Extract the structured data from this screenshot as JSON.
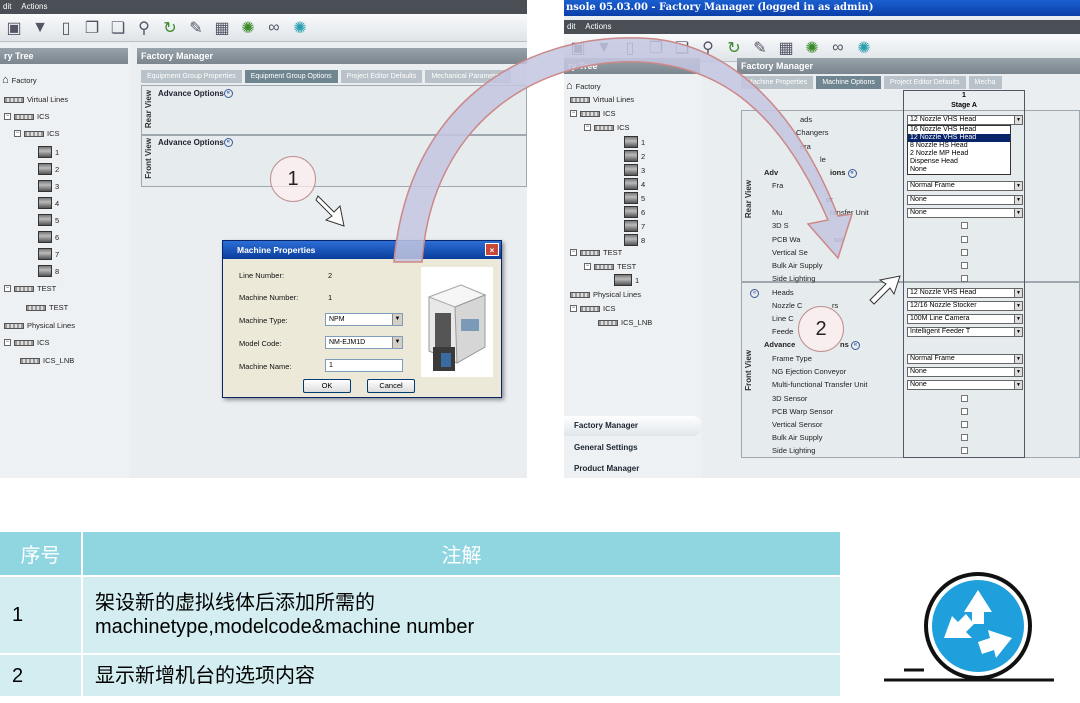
{
  "left_shot": {
    "menu": [
      "dit",
      "Actions"
    ],
    "tree_header": "ry Tree",
    "tree": [
      {
        "label": "Factory"
      },
      {
        "label": "Virtual Lines"
      },
      {
        "label": "ICS"
      },
      {
        "label": "ICS"
      },
      {
        "label": "1"
      },
      {
        "label": "2"
      },
      {
        "label": "3"
      },
      {
        "label": "4"
      },
      {
        "label": "5"
      },
      {
        "label": "6"
      },
      {
        "label": "7"
      },
      {
        "label": "8"
      },
      {
        "label": "TEST"
      },
      {
        "label": "TEST"
      },
      {
        "label": "Physical Lines"
      },
      {
        "label": "ICS"
      },
      {
        "label": "ICS_LNB"
      }
    ],
    "main_header": "Factory Manager",
    "tabs": [
      "Equipment Group Properties",
      "Equipment Group Options",
      "Project Editor Defaults",
      "Mechanical Parameters"
    ],
    "rear_view": "Rear View",
    "front_view": "Front View",
    "advance_options": "Advance Options",
    "dialog": {
      "title": "Machine Properties",
      "line_number_label": "Line Number:",
      "line_number_value": "2",
      "machine_number_label": "Machine Number:",
      "machine_number_value": "1",
      "machine_type_label": "Machine Type:",
      "machine_type_value": "NPM",
      "model_code_label": "Model Code:",
      "model_code_value": "NM-EJM1D",
      "machine_name_label": "Machine Name:",
      "machine_name_value": "1",
      "ok": "OK",
      "cancel": "Cancel"
    }
  },
  "right_shot": {
    "title": "nsole 05.03.00 - Factory Manager (logged in as admin)",
    "menu": [
      "dit",
      "Actions"
    ],
    "tree_header": "ry Tree",
    "tree": [
      {
        "label": "Factory"
      },
      {
        "label": "Virtual Lines"
      },
      {
        "label": "ICS"
      },
      {
        "label": "ICS"
      },
      {
        "label": "1"
      },
      {
        "label": "2"
      },
      {
        "label": "3"
      },
      {
        "label": "4"
      },
      {
        "label": "5"
      },
      {
        "label": "6"
      },
      {
        "label": "7"
      },
      {
        "label": "8"
      },
      {
        "label": "TEST"
      },
      {
        "label": "TEST"
      },
      {
        "label": "1"
      },
      {
        "label": "Physical Lines"
      },
      {
        "label": "ICS"
      },
      {
        "label": "ICS_LNB"
      }
    ],
    "main_header": "Factory Manager",
    "tabs": [
      "Machine Properties",
      "Machine Options",
      "Project Editor Defaults",
      "Mecha"
    ],
    "stage_number": "1",
    "stage_name": "Stage A",
    "rear_view": "Rear View",
    "front_view": "Front View",
    "rear_labels": [
      "ads",
      "Changers",
      "era",
      "le",
      "Adv",
      "ions",
      "Fra",
      "or",
      "Mu",
      "ransfer Unit",
      "3D S",
      "PCB Wa",
      "sor",
      "Vertical Se",
      "Bulk Air Supply",
      "Side Lighting"
    ],
    "rear_values": [
      "12 Nozzle VHS Head",
      "Normal Frame",
      "None",
      "None"
    ],
    "dropdown_options": [
      "16 Nozzle VHS Head",
      "12 Nozzle VHS Head",
      "8 Nozzle HS Head",
      "2 Nozzle MP Head",
      "Dispense Head",
      "None"
    ],
    "front_labels": [
      "Heads",
      "Nozzle C",
      "rs",
      "Line C",
      "Feede",
      "Advance",
      "ns",
      "Frame Type",
      "NG Ejection Conveyor",
      "Multi-functional Transfer Unit",
      "3D Sensor",
      "PCB Warp Sensor",
      "Vertical Sensor",
      "Bulk Air Supply",
      "Side Lighting"
    ],
    "front_values": [
      "12 Nozzle VHS Head",
      "12/16 Nozzle Stocker",
      "100M Line Camera",
      "Intelligent Feeder T",
      "Normal Frame",
      "None",
      "None"
    ],
    "sidebar": [
      "Factory Manager",
      "General Settings",
      "Product Manager"
    ]
  },
  "callouts": [
    "1",
    "2"
  ],
  "notes_table": {
    "headers": [
      "序号",
      "注解"
    ],
    "rows": [
      {
        "num": "1",
        "line1": "架设新的虚拟线体后添加所需的",
        "line2": "machinetype,modelcode&machine number"
      },
      {
        "num": "2",
        "line1": "显示新增机台的选项内容",
        "line2": ""
      }
    ]
  },
  "colors": {
    "table_header": "#8fd6e0",
    "table_row": "#d3edf0",
    "logo": "#1f9fdc"
  }
}
